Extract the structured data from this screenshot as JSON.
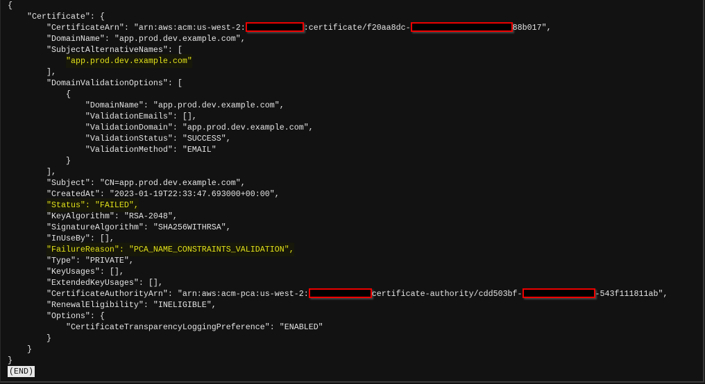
{
  "pager_end_label": "(END)",
  "lines": [
    {
      "indent": 0,
      "parts": [
        "{"
      ]
    },
    {
      "indent": 4,
      "parts": [
        "\"Certificate\": {"
      ]
    },
    {
      "indent": 8,
      "parts": [
        "\"CertificateArn\": \"arn:aws:acm:us-west-2:",
        {
          "redacted": 12
        },
        ":certificate/f20aa8dc-",
        {
          "redacted": 21
        },
        "88b017\","
      ]
    },
    {
      "indent": 8,
      "parts": [
        "\"DomainName\": \"app.prod.dev.example.com\","
      ]
    },
    {
      "indent": 8,
      "parts": [
        "\"SubjectAlternativeNames\": ["
      ]
    },
    {
      "indent": 12,
      "highlight": true,
      "parts": [
        "\"app.prod.dev.example.com\""
      ]
    },
    {
      "indent": 8,
      "parts": [
        "],"
      ]
    },
    {
      "indent": 8,
      "parts": [
        "\"DomainValidationOptions\": ["
      ]
    },
    {
      "indent": 12,
      "parts": [
        "{"
      ]
    },
    {
      "indent": 16,
      "parts": [
        "\"DomainName\": \"app.prod.dev.example.com\","
      ]
    },
    {
      "indent": 16,
      "parts": [
        "\"ValidationEmails\": [],"
      ]
    },
    {
      "indent": 16,
      "parts": [
        "\"ValidationDomain\": \"app.prod.dev.example.com\","
      ]
    },
    {
      "indent": 16,
      "parts": [
        "\"ValidationStatus\": \"SUCCESS\","
      ]
    },
    {
      "indent": 16,
      "parts": [
        "\"ValidationMethod\": \"EMAIL\""
      ]
    },
    {
      "indent": 12,
      "parts": [
        "}"
      ]
    },
    {
      "indent": 8,
      "parts": [
        "],"
      ]
    },
    {
      "indent": 8,
      "parts": [
        "\"Subject\": \"CN=app.prod.dev.example.com\","
      ]
    },
    {
      "indent": 8,
      "parts": [
        "\"CreatedAt\": \"2023-01-19T22:33:47.693000+00:00\","
      ]
    },
    {
      "indent": 8,
      "highlight": true,
      "parts": [
        "\"Status\": \"FAILED\","
      ]
    },
    {
      "indent": 8,
      "parts": [
        "\"KeyAlgorithm\": \"RSA-2048\","
      ]
    },
    {
      "indent": 8,
      "parts": [
        "\"SignatureAlgorithm\": \"SHA256WITHRSA\","
      ]
    },
    {
      "indent": 8,
      "parts": [
        "\"InUseBy\": [],"
      ]
    },
    {
      "indent": 8,
      "highlight": true,
      "parts": [
        "\"FailureReason\": \"PCA_NAME_CONSTRAINTS_VALIDATION\","
      ]
    },
    {
      "indent": 8,
      "parts": [
        "\"Type\": \"PRIVATE\","
      ]
    },
    {
      "indent": 8,
      "parts": [
        "\"KeyUsages\": [],"
      ]
    },
    {
      "indent": 8,
      "parts": [
        "\"ExtendedKeyUsages\": [],"
      ]
    },
    {
      "indent": 8,
      "parts": [
        "\"CertificateAuthorityArn\": \"arn:aws:acm-pca:us-west-2:",
        {
          "redacted": 13
        },
        "certificate-authority/cdd503bf-",
        {
          "redacted": 15
        },
        "-543f111811ab\","
      ]
    },
    {
      "indent": 8,
      "parts": [
        "\"RenewalEligibility\": \"INELIGIBLE\","
      ]
    },
    {
      "indent": 8,
      "parts": [
        "\"Options\": {"
      ]
    },
    {
      "indent": 12,
      "parts": [
        "\"CertificateTransparencyLoggingPreference\": \"ENABLED\""
      ]
    },
    {
      "indent": 8,
      "parts": [
        "}"
      ]
    },
    {
      "indent": 4,
      "parts": [
        "}"
      ]
    },
    {
      "indent": 0,
      "parts": [
        "}"
      ]
    }
  ]
}
